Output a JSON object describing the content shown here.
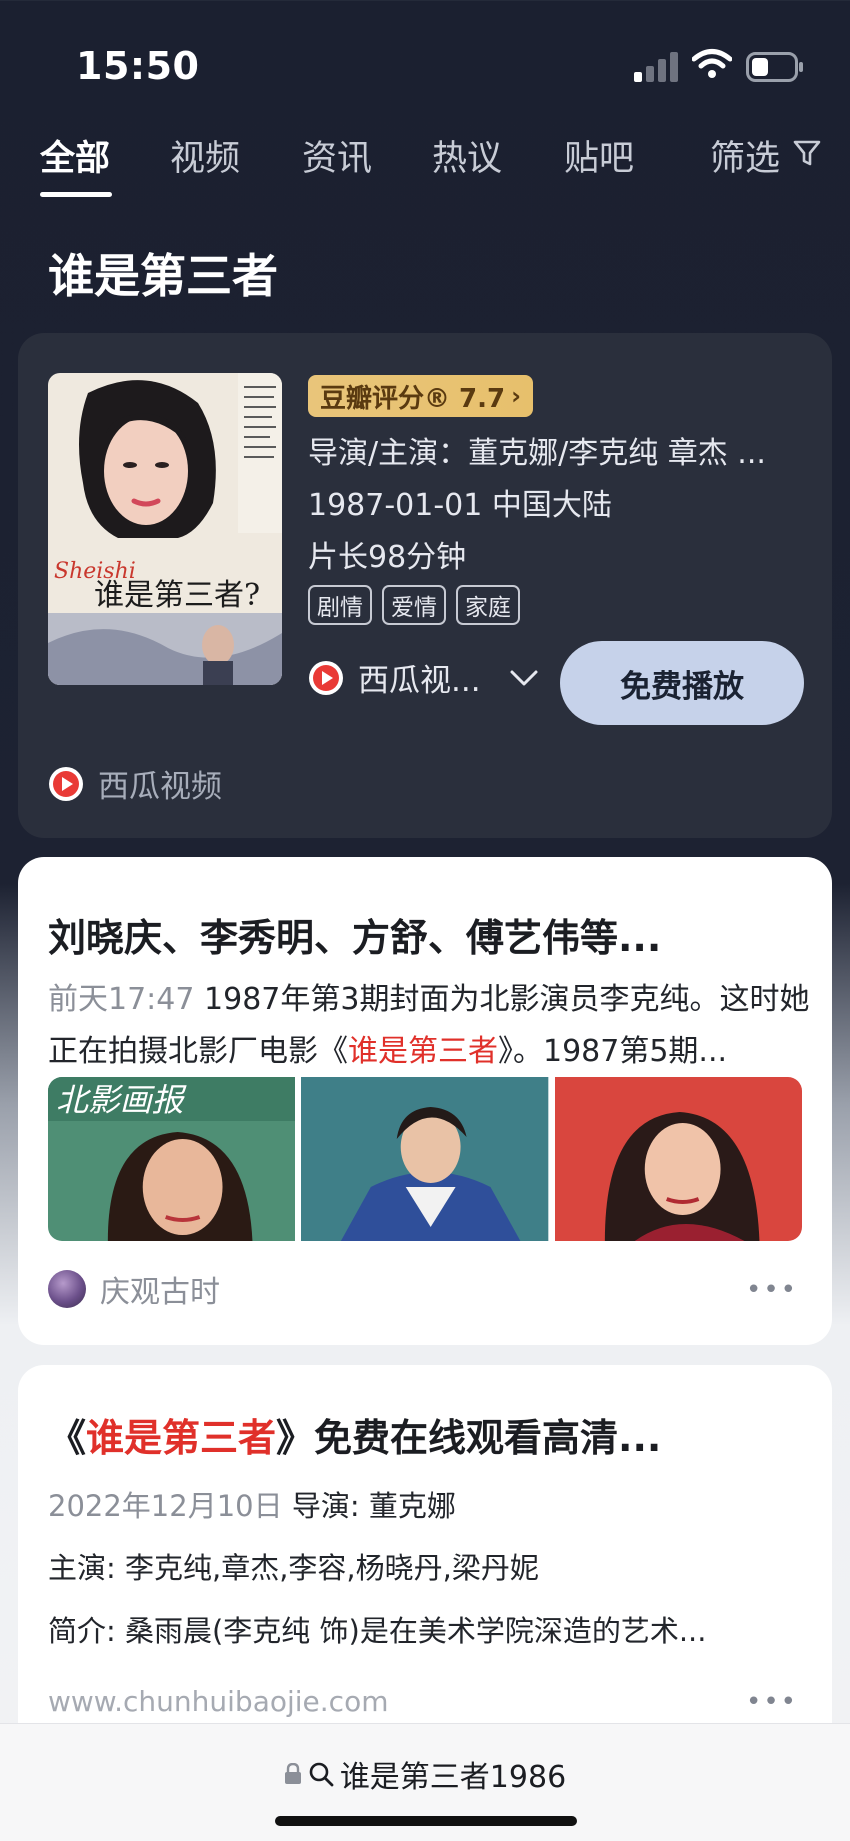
{
  "status_bar": {
    "time": "15:50"
  },
  "tabs": [
    {
      "label": "全部",
      "active": true
    },
    {
      "label": "视频",
      "active": false
    },
    {
      "label": "资讯",
      "active": false
    },
    {
      "label": "热议",
      "active": false
    },
    {
      "label": "贴吧",
      "active": false
    },
    {
      "label": "筛选",
      "active": false
    }
  ],
  "result_title": "谁是第三者",
  "movie": {
    "poster_text": "谁是第三者?",
    "rating_label": "豆瓣评分® 7.7",
    "cast": "导演/主演：董克娜/李克纯 章杰 ...",
    "release": "1987-01-01 中国大陆",
    "duration": "片长98分钟",
    "genres": [
      "剧情",
      "爱情",
      "家庭"
    ],
    "source": "西瓜视...",
    "play_button": "免费播放",
    "provider": "西瓜视频"
  },
  "article1": {
    "title": "刘晓庆、李秀明、方舒、傅艺伟等...",
    "time": "前天17:47",
    "text_a": "1987年第3期封面为北影演员李克纯。这时她正在拍摄北影厂电影《",
    "text_hl": "谁是第三者",
    "text_b": "》。1987第5期...",
    "author": "庆观古时",
    "more": "•••"
  },
  "article2": {
    "title_open": "《",
    "title_hl": "谁是第三者",
    "title_rest": "》免费在线观看高清...",
    "date": "2022年12月10日",
    "director": "导演:  董克娜",
    "cast": "主演:  李克纯,章杰,李容,杨晓丹,梁丹妮",
    "summary": "简介:  桑雨晨(李克纯 饰)是在美术学院深造的艺术...",
    "site": "www.chunhuibaojie.com",
    "more": "•••"
  },
  "address_bar": {
    "query": "谁是第三者1986"
  },
  "colors": {
    "accent_red": "#e0302a",
    "rating_gold": "#e9c57a",
    "play_button": "#c6d2ea"
  }
}
